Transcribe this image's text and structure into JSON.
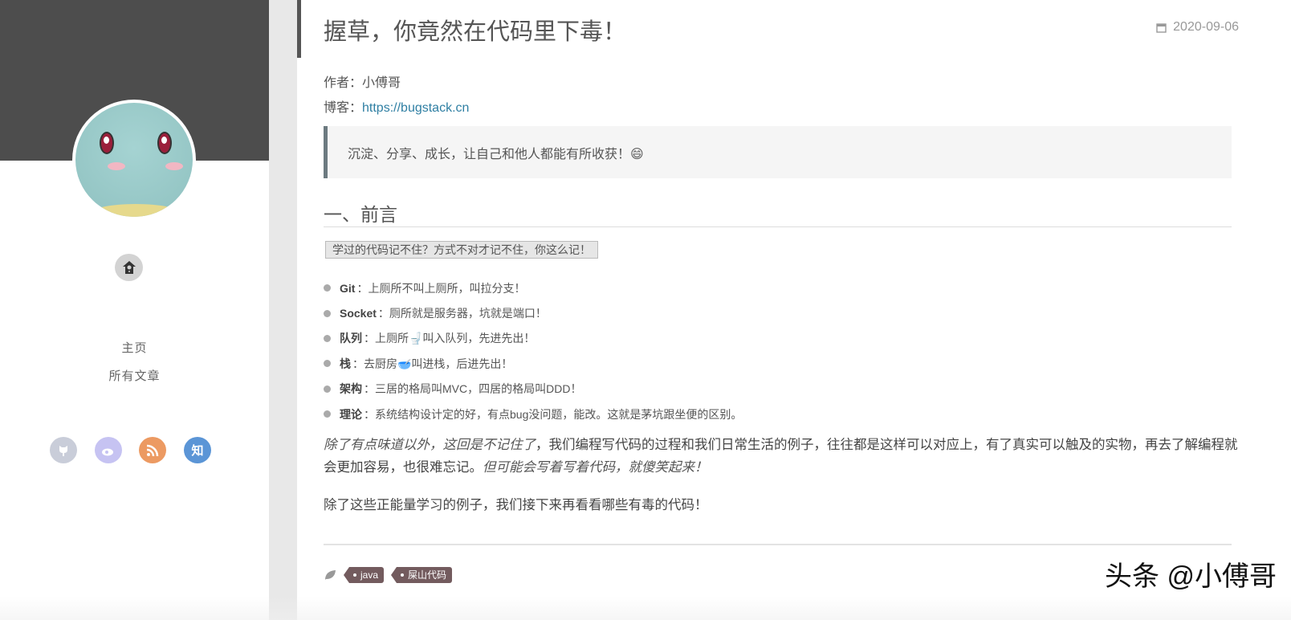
{
  "sidebar": {
    "nav": [
      {
        "label": "主页"
      },
      {
        "label": "所有文章"
      }
    ],
    "social": [
      {
        "icon": "github-icon",
        "color": "#c9cdd9"
      },
      {
        "icon": "weibo-icon",
        "color": "#c6c3f2"
      },
      {
        "icon": "rss-icon",
        "color": "#ec9a62"
      },
      {
        "icon": "zhihu-icon",
        "label": "知",
        "color": "#5b95d6"
      }
    ]
  },
  "article": {
    "title": "握草，你竟然在代码里下毒！",
    "date": "2020-09-06",
    "author_label": "作者：",
    "author": "小傅哥",
    "blog_label": "博客：",
    "blog_url": "https://bugstack.cn",
    "quote": "沉淀、分享、成长，让自己和他人都能有所收获！😄",
    "section_heading": "一、前言",
    "highlight": "学过的代码记不住？方式不对才记不住，你这么记！",
    "list": [
      {
        "term": "Git",
        "text": "：上厕所不叫上厕所，叫拉分支！"
      },
      {
        "term": "Socket",
        "text": "：厕所就是服务器，坑就是端口！"
      },
      {
        "term": "队列",
        "text": "：上厕所🚽叫入队列，先进先出！"
      },
      {
        "term": "栈",
        "text": "：去厨房🥣叫进栈，后进先出！"
      },
      {
        "term": "架构",
        "text": "：三居的格局叫MVC，四居的格局叫DDD！"
      },
      {
        "term": "理论",
        "text": "：系统结构设计定的好，有点bug没问题，能改。这就是茅坑跟坐便的区别。"
      }
    ],
    "para1_italic1": "除了有点味道以外，这回是不记住了",
    "para1_text": "，我们编程写代码的过程和我们日常生活的例子，往往都是这样可以对应上，有了真实可以触及的实物，再去了解编程就会更加容易，也很难忘记。",
    "para1_italic2": "但可能会写着写着代码，就傻笑起来！",
    "para2": "除了这些正能量学习的例子，我们接下来再看看哪些有毒的代码！",
    "tags": [
      "java",
      "屎山代码"
    ]
  },
  "watermark": "头条 @小傅哥"
}
